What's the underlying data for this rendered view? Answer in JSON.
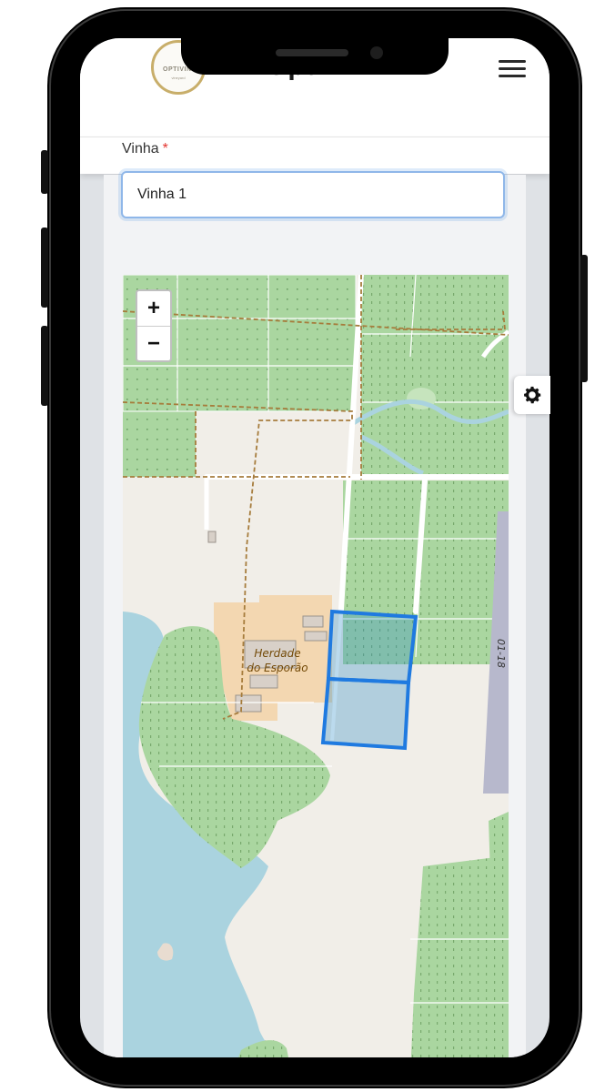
{
  "header": {
    "title": "OptiVini",
    "logo_text": "OPTIVINI",
    "logo_subtext": "vineyard"
  },
  "form": {
    "vinha_label": "Vinha",
    "required_mark": "*",
    "vinha_value": "Vinha 1"
  },
  "map": {
    "zoom_in_label": "+",
    "zoom_out_label": "−",
    "place_label_line1": "Herdade",
    "place_label_line2": "do Esporão",
    "road_label": "01-18",
    "selected_parcels": 2
  },
  "icons": {
    "menu": "hamburger-menu-icon",
    "settings": "gear-icon"
  },
  "colors": {
    "vineyard": "#aad6a0",
    "water": "#aad3df",
    "selection": "#1f7ae0",
    "required": "#e3342f"
  }
}
